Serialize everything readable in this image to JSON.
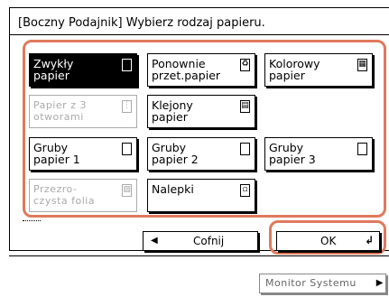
{
  "dialog": {
    "title": "[Boczny Podajnik] Wybierz rodzaj papieru."
  },
  "paper_types": [
    {
      "label": "Zwykły\npapier",
      "icon": "plain-sheet-icon",
      "glyph": "",
      "selected": true,
      "enabled": true
    },
    {
      "label": "Ponownie\nprzet.papier",
      "icon": "recycled-paper-icon",
      "glyph": "♻",
      "selected": false,
      "enabled": true
    },
    {
      "label": "Kolorowy\npapier",
      "icon": "color-paper-icon",
      "glyph": "▦",
      "selected": false,
      "enabled": true
    },
    {
      "label": "Papier z 3\notworami",
      "icon": "punched-paper-icon",
      "glyph": "⋮",
      "selected": false,
      "enabled": false
    },
    {
      "label": "Klejony\npapier",
      "icon": "bond-paper-icon",
      "glyph": "▤",
      "selected": false,
      "enabled": true
    },
    {
      "label": "Gruby\npapier 1",
      "icon": "heavy-paper-1-icon",
      "glyph": "",
      "selected": false,
      "enabled": true
    },
    {
      "label": "Gruby\npapier 2",
      "icon": "heavy-paper-2-icon",
      "glyph": "",
      "selected": false,
      "enabled": true
    },
    {
      "label": "Gruby\npapier 3",
      "icon": "heavy-paper-3-icon",
      "glyph": "",
      "selected": false,
      "enabled": true
    },
    {
      "label": "Przezro-\nczysta folia",
      "icon": "transparency-icon",
      "glyph": "▨",
      "selected": false,
      "enabled": false
    },
    {
      "label": "Nalepki",
      "icon": "labels-icon",
      "glyph": "▫",
      "selected": false,
      "enabled": true
    }
  ],
  "actions": {
    "back_label": "Cofnij",
    "back_icon": "left-arrow-icon",
    "ok_label": "OK",
    "ok_icon": "enter-icon"
  },
  "footer": {
    "monitor_label": "Monitor Systemu"
  }
}
